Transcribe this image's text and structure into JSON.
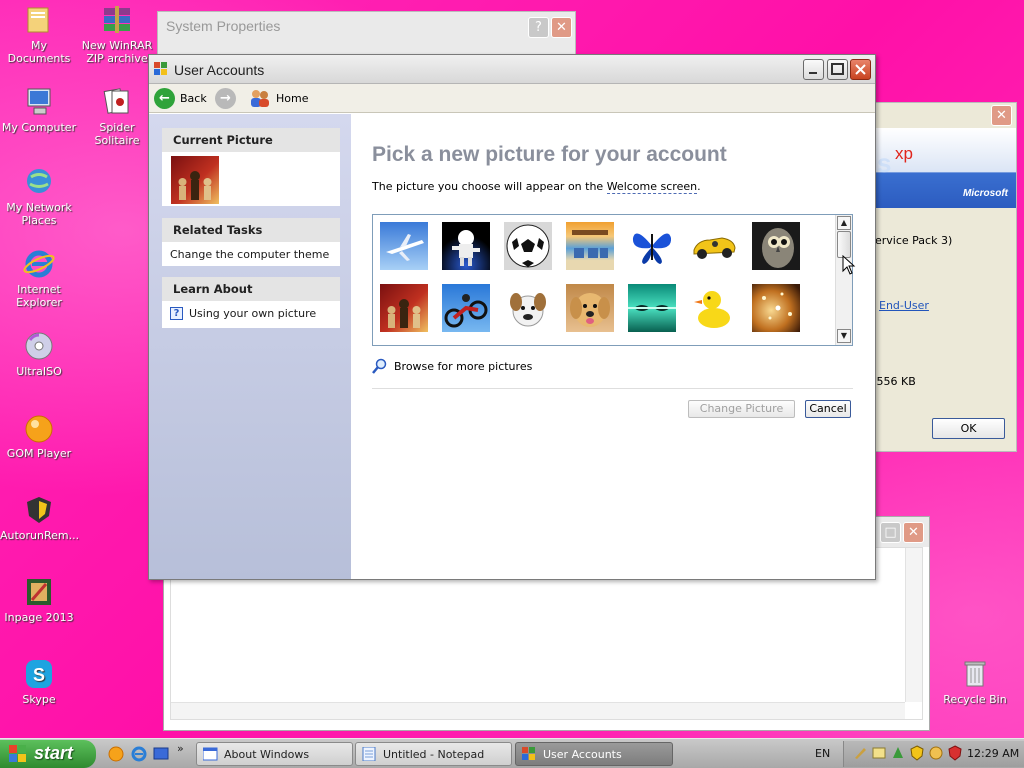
{
  "desktop": {
    "icons": [
      {
        "label": "My Documents"
      },
      {
        "label": "New WinRAR ZIP archive"
      },
      {
        "label": "My Computer"
      },
      {
        "label": "Spider Solitaire"
      },
      {
        "label": "My Network Places"
      },
      {
        "label": "Internet Explorer"
      },
      {
        "label": "UltraISO"
      },
      {
        "label": "GOM Player"
      },
      {
        "label": "AutorunRem..."
      },
      {
        "label": "Inpage 2013"
      },
      {
        "label": "Skype"
      },
      {
        "label": "Recycle Bin"
      }
    ]
  },
  "system_properties": {
    "title": "System Properties",
    "about_logo_suffix": "xp",
    "about_brand": "Microsoft",
    "service_pack_text": "ervice Pack 3)",
    "eula_link": "End-User",
    "memory_text": ",556 KB",
    "ok_label": "OK"
  },
  "user_accounts": {
    "title": "User Accounts",
    "toolbar": {
      "back_label": "Back",
      "home_label": "Home"
    },
    "sidebar": {
      "current_picture_header": "Current Picture",
      "related_tasks_header": "Related Tasks",
      "related_tasks_item": "Change the computer theme",
      "learn_about_header": "Learn About",
      "learn_about_item": "Using your own picture"
    },
    "heading": "Pick a new picture for your account",
    "description_prefix": "The picture you choose will appear on the ",
    "description_link": "Welcome screen",
    "description_suffix": ".",
    "pictures": [
      "airplane",
      "astronaut",
      "soccer-ball",
      "beach-chairs",
      "butterfly",
      "race-car",
      "owl",
      "chess",
      "dirt-bike",
      "dog",
      "puppy",
      "fish",
      "rubber-duck",
      "sparkles"
    ],
    "browse_label": "Browse for more pictures",
    "change_picture_label": "Change Picture",
    "cancel_label": "Cancel"
  },
  "taskbar": {
    "start_label": "start",
    "tasks": [
      {
        "label": "About Windows"
      },
      {
        "label": "Untitled - Notepad"
      },
      {
        "label": "User Accounts"
      }
    ],
    "language": "EN",
    "clock": "12:29 AM"
  }
}
